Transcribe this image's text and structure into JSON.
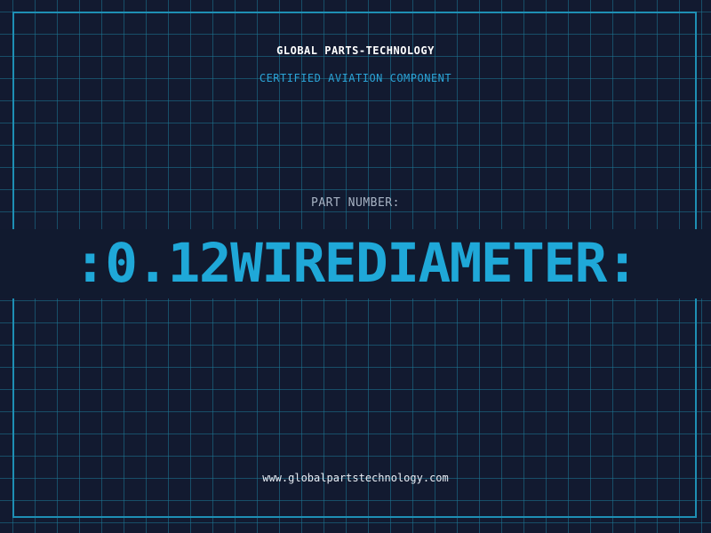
{
  "header": {
    "company": "GLOBAL PARTS-TECHNOLOGY",
    "subtitle": "CERTIFIED AVIATION COMPONENT"
  },
  "part": {
    "label": "PART NUMBER:",
    "number": ":0.12WIREDIAMETER:"
  },
  "footer": {
    "url": "www.globalpartstechnology.com"
  },
  "colors": {
    "background": "#121a30",
    "grid": "#1e7896",
    "frame": "#1e8fb4",
    "accent": "#1fa8d8"
  }
}
